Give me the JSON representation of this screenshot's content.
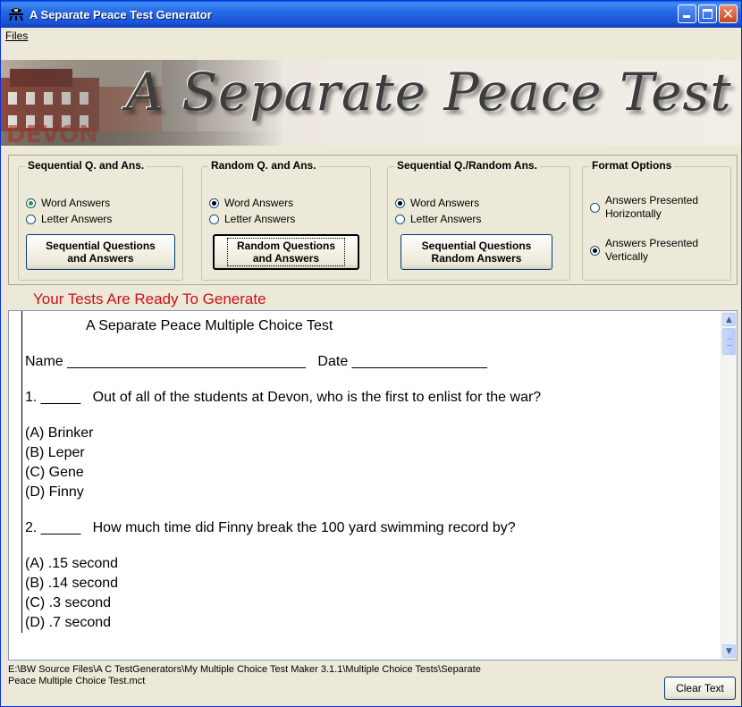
{
  "window": {
    "title": "A Separate Peace Test Generator",
    "controls": [
      "minimize",
      "maximize",
      "close"
    ]
  },
  "menu": {
    "files": "Files"
  },
  "banner": {
    "title": "A Separate Peace Test Generator"
  },
  "groups": {
    "sequential": {
      "title": "Sequential Q. and Ans.",
      "radio1": "Word Answers",
      "radio2": "Letter Answers",
      "button": [
        "Sequential Questions",
        "and Answers"
      ]
    },
    "random": {
      "title": "Random Q. and Ans.",
      "radio1": "Word Answers",
      "radio2": "Letter Answers",
      "button": [
        "Random Questions",
        "and Answers"
      ]
    },
    "seq_random": {
      "title": "Sequential Q./Random Ans.",
      "radio1": "Word Answers",
      "radio2": "Letter Answers",
      "button": [
        "Sequential Questions",
        "Random Answers"
      ]
    },
    "format": {
      "title": "Format Options",
      "opt1": [
        "Answers Presented",
        "Horizontally"
      ],
      "opt2": [
        "Answers Presented",
        "Vertically"
      ]
    }
  },
  "status_message": "Your Tests Are Ready To Generate",
  "document": {
    "heading": "A Separate Peace Multiple Choice Test",
    "name_line": "Name ______________________________   Date _________________",
    "q1": "1. _____   Out of all of the students at Devon, who is the first to enlist for the war?",
    "q1_answers": [
      "(A) Brinker",
      "(B) Leper",
      "(C) Gene",
      "(D) Finny"
    ],
    "q2": "2. _____   How much time did Finny break the 100 yard swimming record by?",
    "q2_answers": [
      "(A) .15 second",
      "(B) .14 second",
      "(C) .3 second",
      "(D) .7 second"
    ]
  },
  "file_path_line1": "E:\\BW Source Files\\A C TestGenerators\\My Multiple Choice Test Maker 3.1.1\\Multiple Choice Tests\\Separate",
  "file_path_line2": "Peace Multiple Choice Test.mct",
  "clear_button": "Clear Text",
  "colors": {
    "titlebar": "#2569e6",
    "status_text": "#c8101a",
    "window_bg": "#ece9d8"
  }
}
